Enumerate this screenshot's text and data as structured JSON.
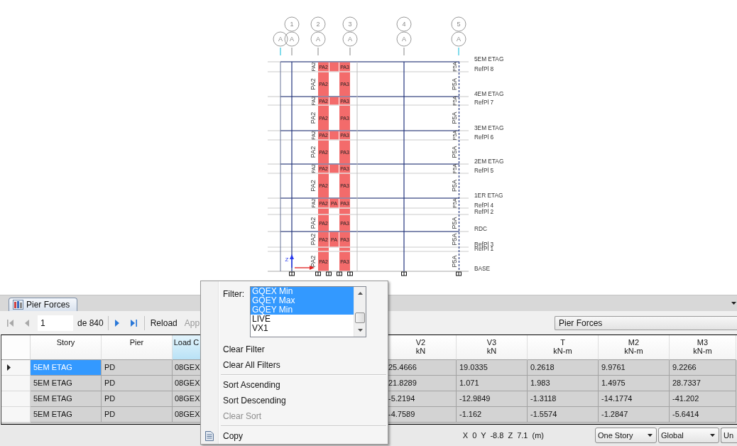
{
  "drawing": {
    "grid_numbers": [
      "1",
      "2",
      "3",
      "4",
      "5"
    ],
    "grid_letters": [
      "A",
      "A",
      "A",
      "A",
      "A",
      "A"
    ],
    "levels": [
      {
        "label": "5EM ETAG",
        "kind": "story"
      },
      {
        "label": "RefPl 8",
        "kind": "reference"
      },
      {
        "label": "4EM ETAG",
        "kind": "story"
      },
      {
        "label": "RefPl 7",
        "kind": "reference"
      },
      {
        "label": "3EM ETAG",
        "kind": "story"
      },
      {
        "label": "RefPl 6",
        "kind": "reference"
      },
      {
        "label": "2EM ETAG",
        "kind": "story"
      },
      {
        "label": "RefPl 5",
        "kind": "reference"
      },
      {
        "label": "1ER ETAG",
        "kind": "story"
      },
      {
        "label": "RefPl 4",
        "kind": "reference"
      },
      {
        "label": "RefPl 2",
        "kind": "reference"
      },
      {
        "label": "RDC",
        "kind": "story"
      },
      {
        "label": "RefPl 3",
        "kind": "reference"
      },
      {
        "label": "RefPl 1",
        "kind": "reference"
      },
      {
        "label": "BASE",
        "kind": "base"
      }
    ],
    "zones": [
      {
        "kind": "band",
        "left": "PA2",
        "wall_left": "PA2",
        "wall_right": "PA3",
        "right": "P5A"
      },
      {
        "kind": "open",
        "left": "PA2",
        "wall_left": "PA2",
        "wall_right": "PA3",
        "right": "P5A"
      },
      {
        "kind": "band",
        "left": "PA2",
        "wall_left": "PA2",
        "wall_right": "PA3",
        "right": "P5A"
      },
      {
        "kind": "open",
        "left": "PA2",
        "wall_left": "PA2",
        "wall_right": "PA3",
        "right": "P5A"
      },
      {
        "kind": "band",
        "left": "PA2",
        "wall_left": "PA2",
        "wall_right": "PA3",
        "right": "P5A"
      },
      {
        "kind": "open",
        "left": "PA2",
        "wall_left": "PA2",
        "wall_right": "PA3",
        "right": "P5A"
      },
      {
        "kind": "band",
        "left": "PA2",
        "wall_left": "PA2",
        "wall_right": "PA3",
        "right": "P5A"
      },
      {
        "kind": "open",
        "left": "PA2",
        "wall_left": "PA2",
        "wall_right": "PA3",
        "right": "P5A"
      },
      {
        "kind": "band",
        "left": "PA2",
        "wall_left": "PA2",
        "wall_middle": "PA",
        "wall_right": "PA3",
        "right": "P5A"
      },
      {
        "kind": "open"
      },
      {
        "kind": "open",
        "left": "PA2",
        "wall_left": "PA2",
        "wall_right": "PA3",
        "right": "P5A"
      },
      {
        "kind": "band",
        "left": "PA2",
        "wall_left": "PA2",
        "wall_middle": "PA",
        "wall_right": "PA3",
        "right": "P5A"
      },
      {
        "kind": "open"
      },
      {
        "kind": "open",
        "left": "PA2",
        "wall_left": "PA2",
        "wall_right": "PA3",
        "right": "P5A"
      }
    ],
    "axis_label": "Z"
  },
  "tabs": [
    {
      "label": "Pier Forces",
      "selected": true
    }
  ],
  "toolbar": {
    "buttons_before": [
      {
        "kind": "first",
        "disabled": true
      },
      {
        "kind": "previous",
        "disabled": true
      }
    ],
    "page": "1",
    "page_total": "de 840",
    "buttons_after": [
      {
        "kind": "next",
        "disabled": false
      },
      {
        "kind": "last",
        "disabled": false
      }
    ],
    "actions": [
      {
        "label": "Reload",
        "disabled": false
      },
      {
        "label": "App",
        "disabled": true
      }
    ],
    "view": "Pier Forces"
  },
  "table": {
    "columns": [
      {
        "name": "Story",
        "selected": false
      },
      {
        "name": "Pier",
        "selected": false
      },
      {
        "name": "Load C",
        "selected": true
      },
      {
        "name": "V2",
        "unit": "kN",
        "selected": false
      },
      {
        "name": "V3",
        "unit": "kN",
        "selected": false
      },
      {
        "name": "T",
        "unit": "kN-m",
        "selected": false
      },
      {
        "name": "M2",
        "unit": "kN-m",
        "selected": false
      },
      {
        "name": "M3",
        "unit": "kN-m",
        "selected": false
      }
    ],
    "rows": [
      {
        "current": true,
        "cells": [
          {
            "text": "5EM ETAG",
            "selected": true
          },
          {
            "text": "PD",
            "selected": false
          },
          {
            "text": "08GEX",
            "selected": false
          },
          {
            "text": "25.4666",
            "selected": false
          },
          {
            "text": "19.0335",
            "selected": false
          },
          {
            "text": "0.2618",
            "selected": false
          },
          {
            "text": "9.9761",
            "selected": false
          },
          {
            "text": "9.2266",
            "selected": false
          }
        ]
      },
      {
        "current": false,
        "cells": [
          {
            "text": "5EM ETAG",
            "selected": false
          },
          {
            "text": "PD",
            "selected": false
          },
          {
            "text": "08GEX",
            "selected": false
          },
          {
            "text": "21.8289",
            "selected": false
          },
          {
            "text": "1.071",
            "selected": false
          },
          {
            "text": "1.983",
            "selected": false
          },
          {
            "text": "1.4975",
            "selected": false
          },
          {
            "text": "28.7337",
            "selected": false
          }
        ]
      },
      {
        "current": false,
        "cells": [
          {
            "text": "5EM ETAG",
            "selected": false
          },
          {
            "text": "PD",
            "selected": false
          },
          {
            "text": "08GEX",
            "selected": false
          },
          {
            "text": "-5.2194",
            "selected": false
          },
          {
            "text": "-12.9849",
            "selected": false
          },
          {
            "text": "-1.3118",
            "selected": false
          },
          {
            "text": "-14.1774",
            "selected": false
          },
          {
            "text": "-41.202",
            "selected": false
          }
        ]
      },
      {
        "current": false,
        "cells": [
          {
            "text": "5EM ETAG",
            "selected": false
          },
          {
            "text": "PD",
            "selected": false
          },
          {
            "text": "08GEX",
            "selected": false
          },
          {
            "text": "-4.7589",
            "selected": false
          },
          {
            "text": "-1.162",
            "selected": false
          },
          {
            "text": "-1.5574",
            "selected": false
          },
          {
            "text": "-1.2847",
            "selected": false
          },
          {
            "text": "-5.6414",
            "selected": false
          }
        ]
      }
    ]
  },
  "status_bar": {
    "coordinates": "X 0 Y -8.8 Z 7.1 (m)",
    "controls": [
      {
        "kind": "dropdown",
        "label": "One Story"
      },
      {
        "kind": "dropdown",
        "label": "Global"
      },
      {
        "kind": "button",
        "label": "Un"
      }
    ]
  },
  "menu": {
    "filter": {
      "label": "Filter:",
      "options": [
        {
          "label": "GQEX Min",
          "selected": true
        },
        {
          "label": "GQEY Max",
          "selected": true
        },
        {
          "label": "GQEY Min",
          "selected": true
        },
        {
          "label": "LIVE",
          "selected": false
        },
        {
          "label": "VX1",
          "selected": false
        }
      ]
    },
    "items": [
      {
        "kind": "item",
        "label": "Clear Filter",
        "disabled": false
      },
      {
        "kind": "item",
        "label": "Clear All Filters",
        "disabled": false
      },
      {
        "kind": "separator"
      },
      {
        "kind": "item",
        "label": "Sort Ascending",
        "disabled": false
      },
      {
        "kind": "item",
        "label": "Sort Descending",
        "disabled": false
      },
      {
        "kind": "item",
        "label": "Clear Sort",
        "disabled": true
      },
      {
        "kind": "separator"
      },
      {
        "kind": "iconitem",
        "label": "Copy",
        "disabled": false
      }
    ]
  }
}
